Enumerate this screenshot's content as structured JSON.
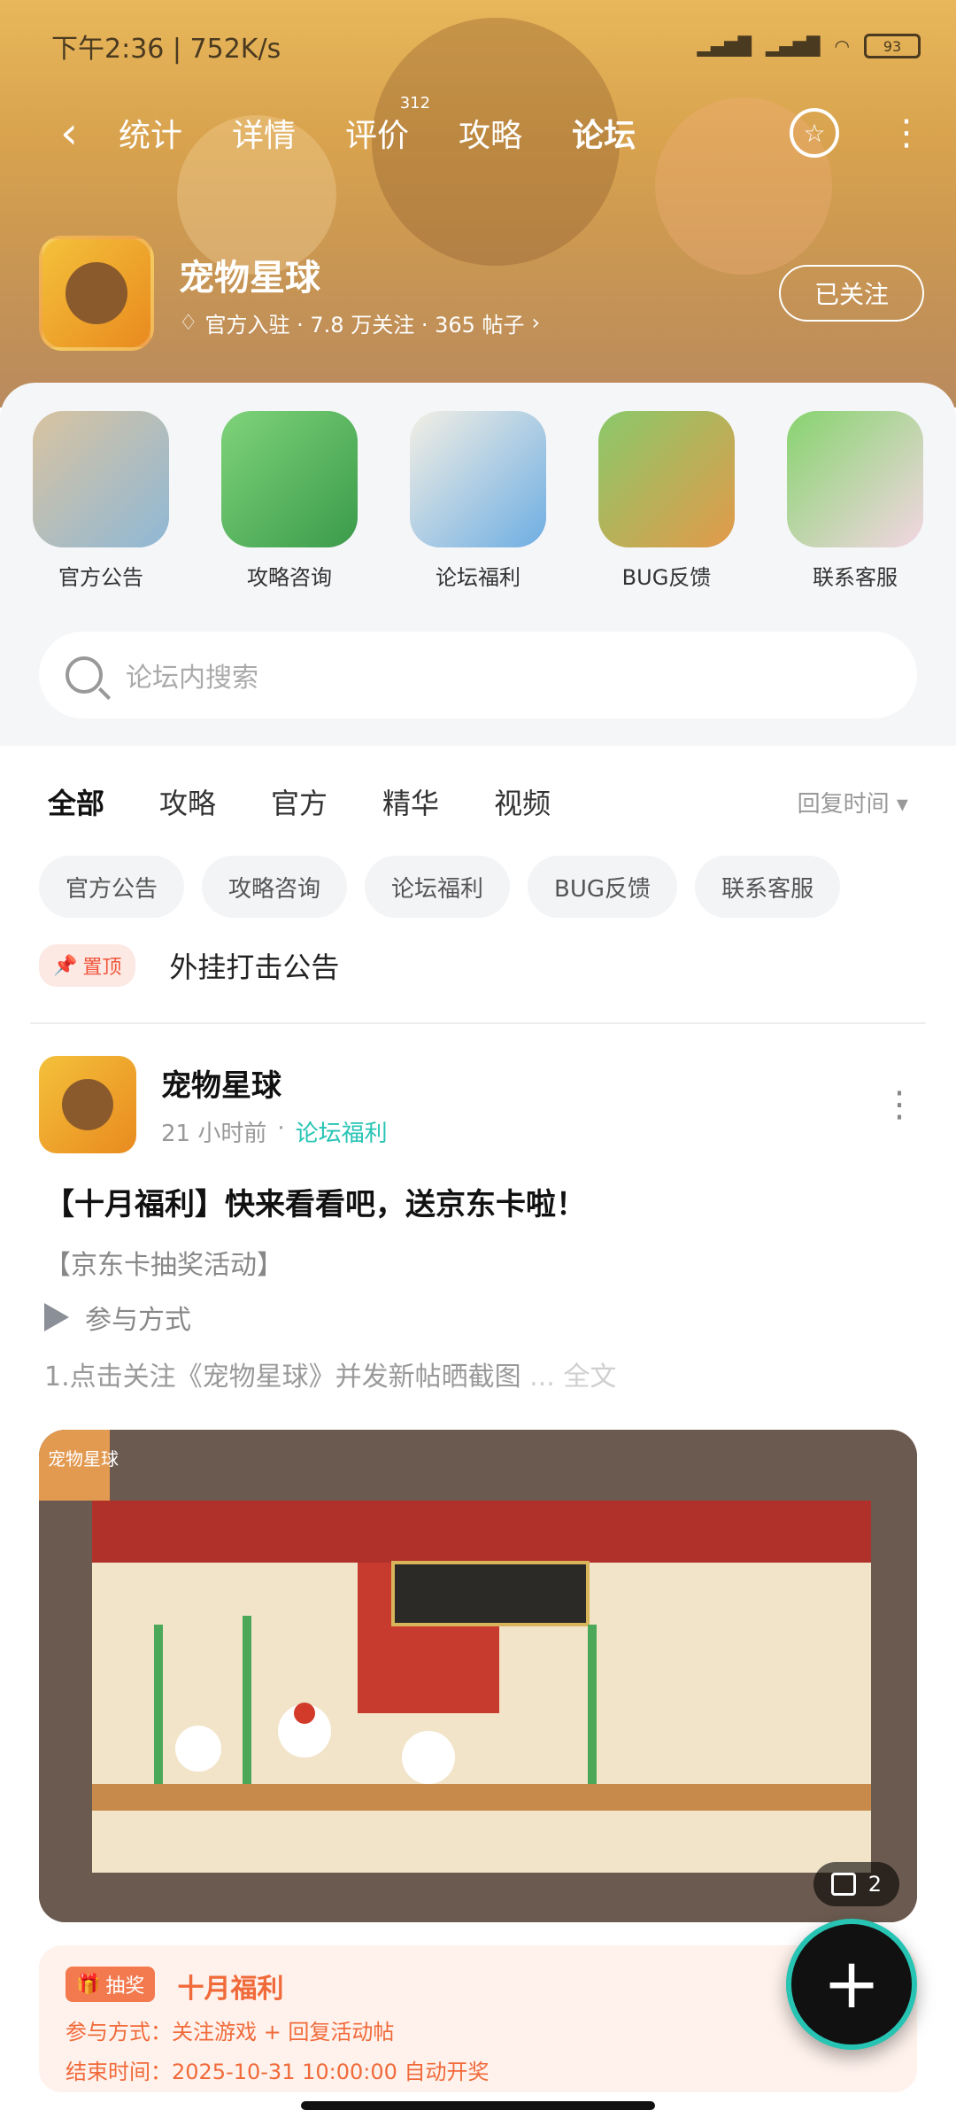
{
  "status": {
    "time_speed": "下午2:36 | 752K/s",
    "battery": "93"
  },
  "nav": {
    "tabs": [
      {
        "label": "统计"
      },
      {
        "label": "详情"
      },
      {
        "label": "评价",
        "badge": "312"
      },
      {
        "label": "攻略"
      },
      {
        "label": "论坛"
      }
    ]
  },
  "game": {
    "name": "宠物星球",
    "sub": "官方入驻 · 7.8 万关注 · 365 帖子",
    "follow_label": "已关注"
  },
  "quick_links": [
    {
      "label": "官方公告"
    },
    {
      "label": "攻略咨询"
    },
    {
      "label": "论坛福利"
    },
    {
      "label": "BUG反馈"
    },
    {
      "label": "联系客服"
    }
  ],
  "search": {
    "placeholder": "论坛内搜索"
  },
  "content_tabs": [
    {
      "label": "全部"
    },
    {
      "label": "攻略"
    },
    {
      "label": "官方"
    },
    {
      "label": "精华"
    },
    {
      "label": "视频"
    }
  ],
  "sort_label": "回复时间 ▾",
  "chips": [
    {
      "label": "官方公告"
    },
    {
      "label": "攻略咨询"
    },
    {
      "label": "论坛福利"
    },
    {
      "label": "BUG反馈"
    },
    {
      "label": "联系客服"
    }
  ],
  "pinned": {
    "tag": "置顶",
    "title": "外挂打击公告"
  },
  "post": {
    "author": "宠物星球",
    "time": "21 小时前",
    "category": "论坛福利",
    "title": "【十月福利】快来看看吧，送京东卡啦！",
    "line1": "【京东卡抽奖活动】",
    "method": "参与方式",
    "desc": "1.点击关注《宠物星球》并发新帖晒截图",
    "more": "... 全文",
    "image_watermark": "宠物星球",
    "image_count": "2",
    "lottery": {
      "tag": "抽奖",
      "title": "十月福利",
      "line1": "参与方式：关注游戏 + 回复活动帖",
      "line2": "结束时间：2025-10-31 10:00:00 自动开奖"
    }
  }
}
